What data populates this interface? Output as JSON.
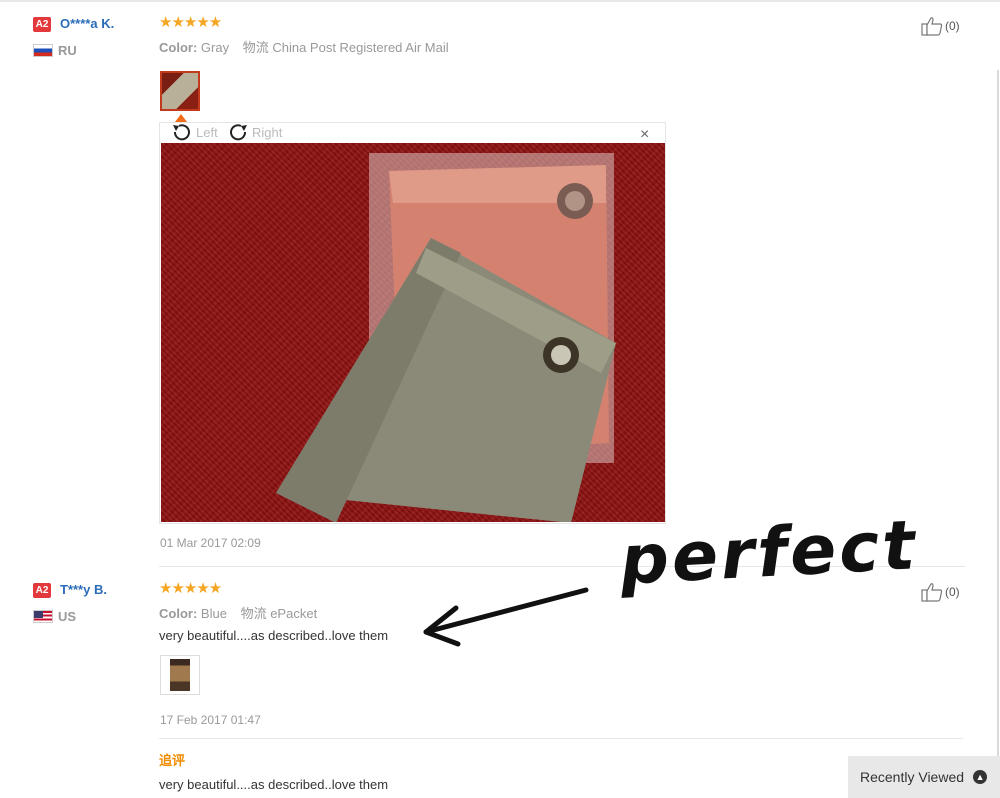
{
  "reviews": [
    {
      "badge": "A2",
      "user": "O****a K.",
      "country": "RU",
      "stars": "★★★★★",
      "color_label": "Color:",
      "color_value": "Gray",
      "shipping_label": "物流",
      "shipping_value": "China Post Registered Air Mail",
      "likes": "(0)",
      "viewer": {
        "left_label": "Left",
        "right_label": "Right",
        "close": "×"
      },
      "date": "01 Mar 2017 02:09"
    },
    {
      "badge": "A2",
      "user": "T***y B.",
      "country": "US",
      "stars": "★★★★★",
      "color_label": "Color:",
      "color_value": "Blue",
      "shipping_label": "物流",
      "shipping_value": "ePacket",
      "likes": "(0)",
      "comment": "very beautiful....as described..love them",
      "date": "17 Feb 2017 01:47",
      "followup_label": "追评",
      "followup_comment": "very beautiful....as described..love them"
    }
  ],
  "annotation": {
    "text": "perfect"
  },
  "recently_viewed": {
    "label": "Recently Viewed",
    "icon": "chevron-up-icon"
  },
  "colors": {
    "username": "#2b6cb8",
    "stars": "#f5a623",
    "badge": "#e4393c",
    "followup": "#f08c00"
  }
}
